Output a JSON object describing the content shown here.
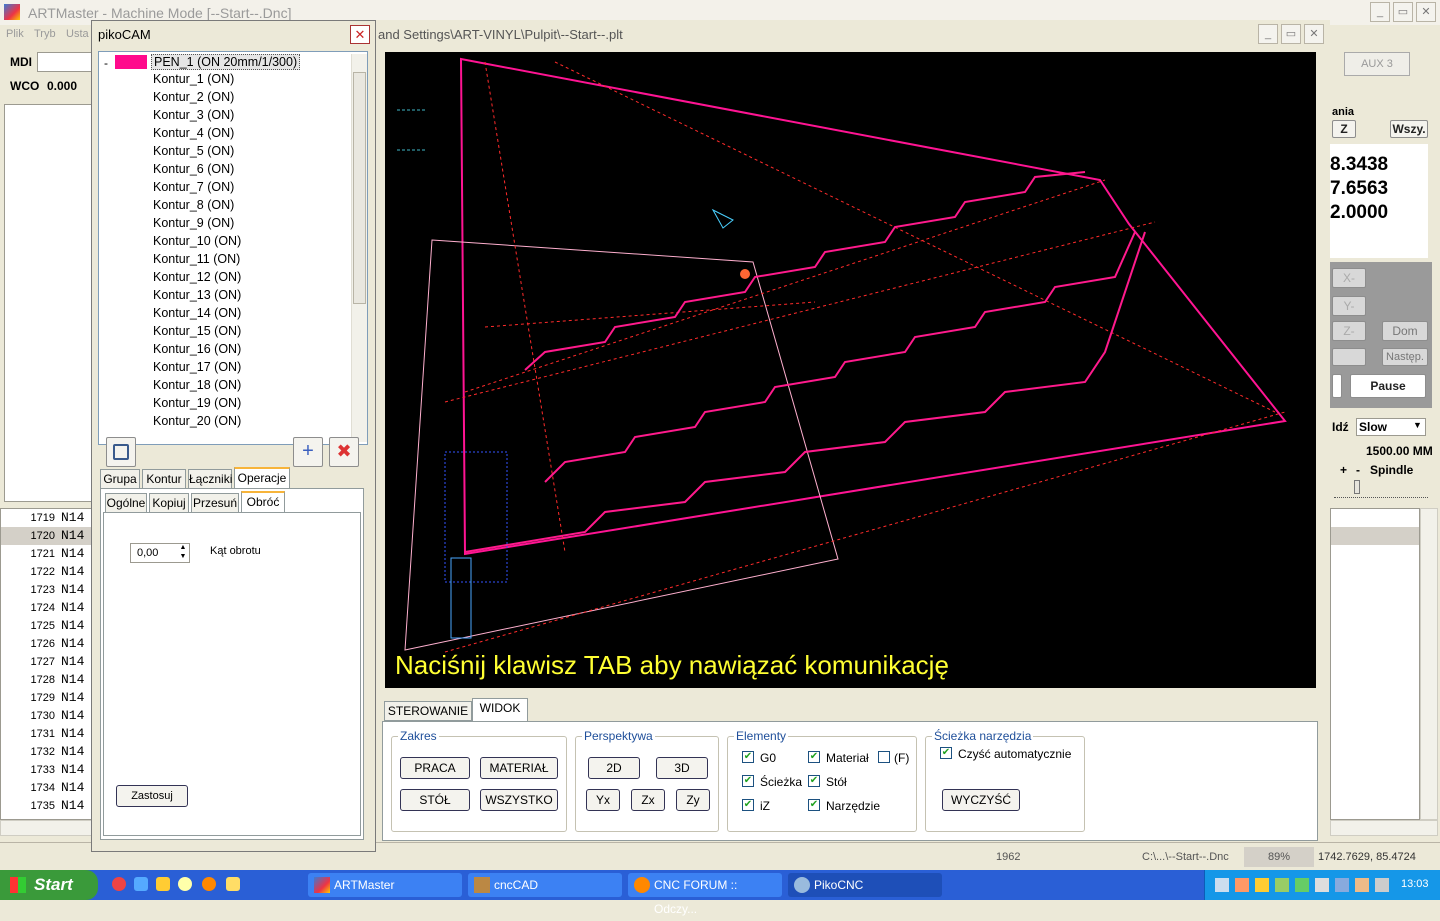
{
  "main_window": {
    "title": "ARTMaster - Machine Mode [--Start--.Dnc]",
    "menu": [
      "Plik",
      "Tryb",
      "Usta"
    ]
  },
  "left_fields": {
    "mdi_label": "MDI",
    "wco_label": "WCO",
    "wco_value": "0.000"
  },
  "nc_lines": [
    {
      "num": "1719",
      "code": "N14"
    },
    {
      "num": "1720",
      "code": "N14"
    },
    {
      "num": "1721",
      "code": "N14"
    },
    {
      "num": "1722",
      "code": "N14"
    },
    {
      "num": "1723",
      "code": "N14"
    },
    {
      "num": "1724",
      "code": "N14"
    },
    {
      "num": "1725",
      "code": "N14"
    },
    {
      "num": "1726",
      "code": "N14"
    },
    {
      "num": "1727",
      "code": "N14"
    },
    {
      "num": "1728",
      "code": "N14"
    },
    {
      "num": "1729",
      "code": "N14"
    },
    {
      "num": "1730",
      "code": "N14"
    },
    {
      "num": "1731",
      "code": "N14"
    },
    {
      "num": "1732",
      "code": "N14"
    },
    {
      "num": "1733",
      "code": "N14"
    },
    {
      "num": "1734",
      "code": "N14"
    },
    {
      "num": "1735",
      "code": "N14"
    }
  ],
  "pikocam": {
    "title": "pikoCAM",
    "root": "PEN_1 (ON 20mm/1/300)",
    "contours": [
      "Kontur_1 (ON)",
      "Kontur_2 (ON)",
      "Kontur_3 (ON)",
      "Kontur_4 (ON)",
      "Kontur_5 (ON)",
      "Kontur_6 (ON)",
      "Kontur_7 (ON)",
      "Kontur_8 (ON)",
      "Kontur_9 (ON)",
      "Kontur_10 (ON)",
      "Kontur_11 (ON)",
      "Kontur_12 (ON)",
      "Kontur_13 (ON)",
      "Kontur_14 (ON)",
      "Kontur_15 (ON)",
      "Kontur_16 (ON)",
      "Kontur_17 (ON)",
      "Kontur_18 (ON)",
      "Kontur_19 (ON)",
      "Kontur_20 (ON)"
    ],
    "tabs_top": [
      "Grupa",
      "Kontur",
      "Łączniki",
      "Operacje"
    ],
    "tabs_sub": [
      "Ogólne",
      "Kopiuj",
      "Przesuń",
      "Obróć"
    ],
    "angle_value": "0,00",
    "angle_label": "Kąt obrotu",
    "apply": "Zastosuj",
    "pen_color": "#ff0a8c"
  },
  "viewer": {
    "title": "and Settings\\ART-VINYL\\Pulpit\\--Start--.plt",
    "message": "Naciśnij klawisz TAB aby nawiązać komunikację",
    "tabs": [
      "STEROWANIE",
      "WIDOK"
    ],
    "zakres": {
      "caption": "Zakres",
      "praca": "PRACA",
      "material": "MATERIAŁ",
      "stol": "STÓŁ",
      "wszystko": "WSZYSTKO"
    },
    "perspektywa": {
      "caption": "Perspektywa",
      "b2d": "2D",
      "b3d": "3D",
      "yx": "Yx",
      "zx": "Zx",
      "zy": "Zy"
    },
    "elementy": {
      "caption": "Elementy",
      "g0": "G0",
      "material": "Materiał",
      "f": "(F)",
      "sciezka": "Ścieżka",
      "stol": "Stół",
      "iz": "iZ",
      "narzedzie": "Narzędzie"
    },
    "sciezka": {
      "caption": "Ścieżka narzędzia",
      "auto": "Czyść automatycznie",
      "clear": "WYCZYŚĆ"
    }
  },
  "right": {
    "aux": "AUX 3",
    "section": "ania",
    "z_btn": "Z",
    "all_btn": "Wszy.",
    "values": [
      "8.3438",
      "7.6563",
      "2.0000"
    ],
    "xminus": "X-",
    "yminus": "Y-",
    "zminus": "Z-",
    "dom": "Dom",
    "next": "Następ.",
    "pause": "Pause",
    "speed_label": "Idź",
    "speed_value": "Slow",
    "feed": "1500.00 MM",
    "plus": "+",
    "minus": "-",
    "spindle": "Spindle"
  },
  "status": {
    "line": "1962",
    "file": "C:\\...\\--Start--.Dnc",
    "pct": "89%",
    "coords": "1742.7629, 85.4724"
  },
  "taskbar": {
    "start": "Start",
    "tasks": [
      "ARTMaster",
      "cncCAD",
      "CNC FORUM :: Odczy...",
      "PikoCNC"
    ],
    "clock": "13:03"
  }
}
